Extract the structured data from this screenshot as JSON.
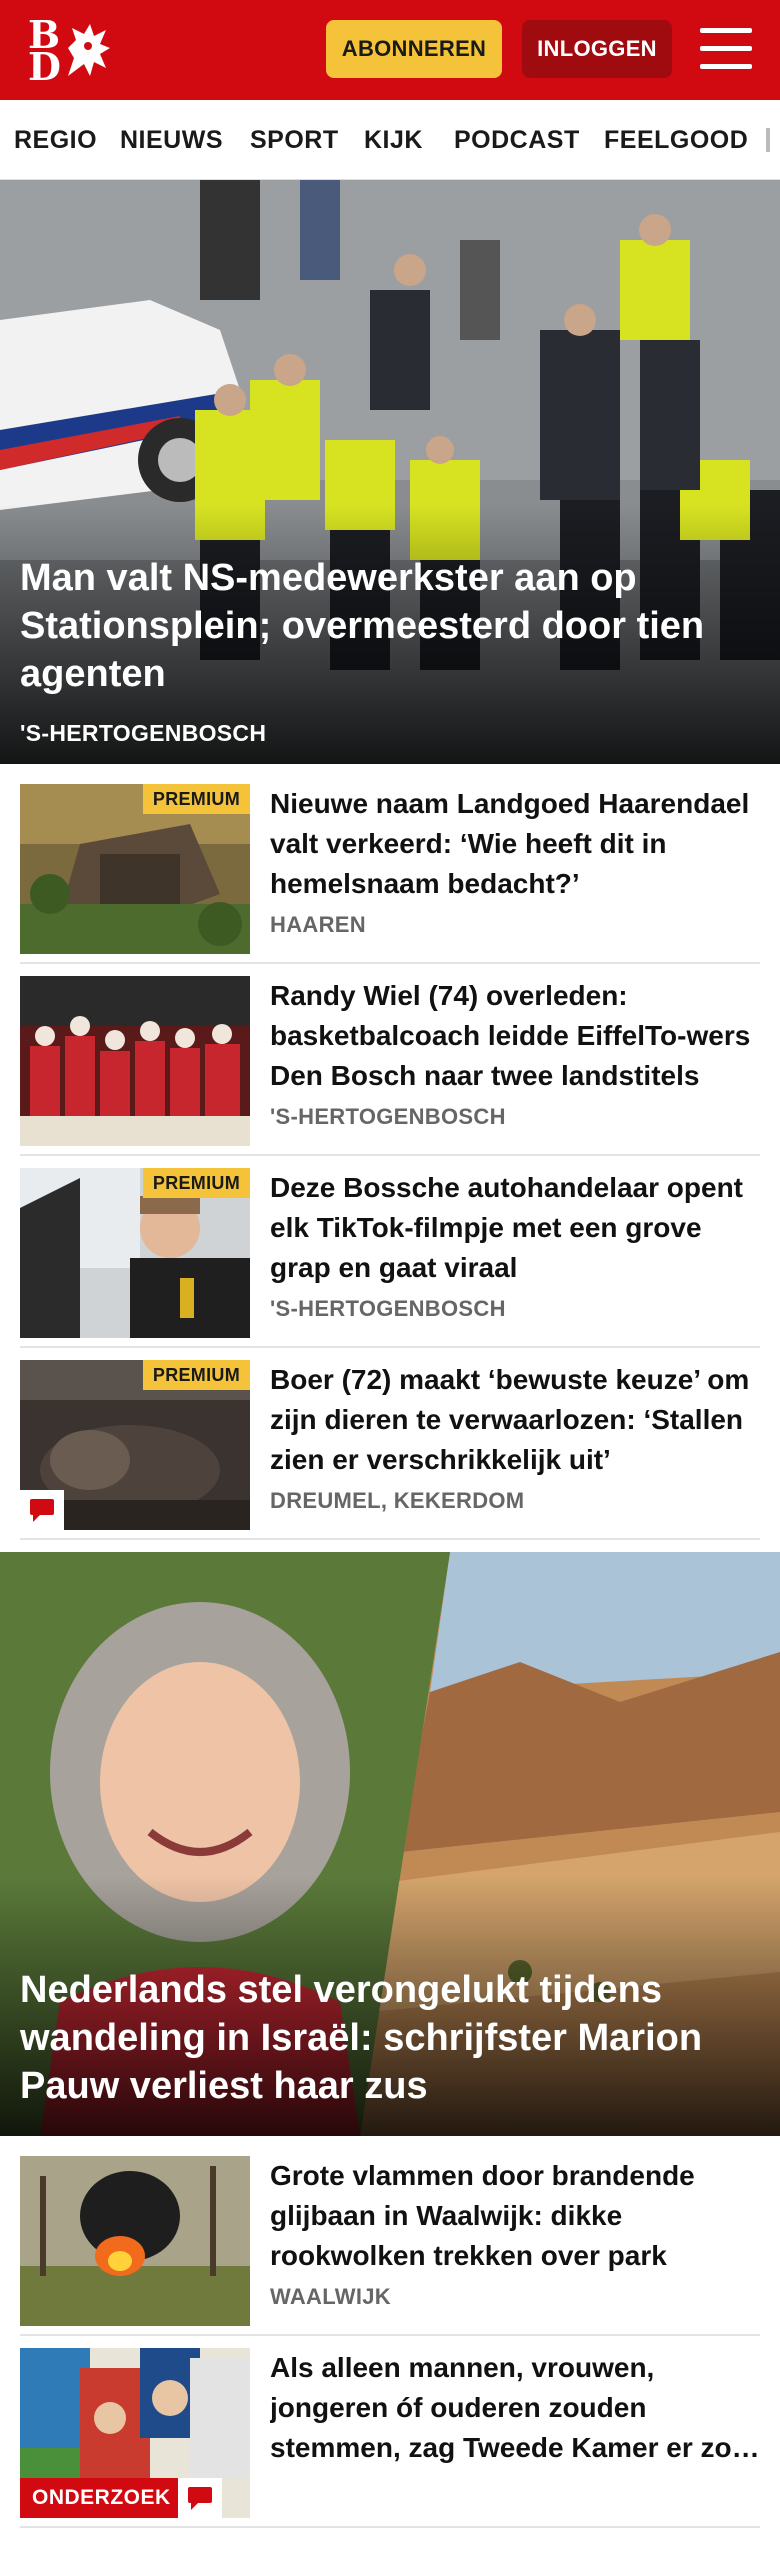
{
  "header": {
    "subscribe_label": "ABONNEREN",
    "login_label": "INLOGGEN",
    "colors": {
      "brand": "#d10a11",
      "subscribe": "#f5c33a",
      "login": "#a00b10"
    }
  },
  "nav": {
    "items": [
      "REGIO",
      "NIEUWS",
      "SPORT",
      "KIJK",
      "PODCAST",
      "FEELGOOD"
    ]
  },
  "hero1": {
    "title": "Man valt NS-medewerkster aan op Stationsplein; overmeesterd door tien agenten",
    "location": "'S-HERTOGENBOSCH"
  },
  "articles1": [
    {
      "title": "Nieuwe naam Landgoed Haarendael valt verkeerd: ‘Wie heeft dit in hemelsnaam bedacht?’",
      "location": "HAAREN",
      "badge": "PREMIUM"
    },
    {
      "title": "Randy Wiel (74) overleden: basketbalcoach leidde EiffelTo-wers Den Bosch naar twee landstitels",
      "location": "'S-HERTOGENBOSCH"
    },
    {
      "title": "Deze Bossche autohandelaar opent elk TikTok-filmpje met een grove grap en gaat viraal",
      "location": "'S-HERTOGENBOSCH",
      "badge": "PREMIUM"
    },
    {
      "title": "Boer (72) maakt ‘bewuste keuze’ om zijn dieren te verwaarlozen: ‘Stallen zien er verschrikkelijk uit’",
      "location": "DREUMEL, KEKERDOM",
      "badge": "PREMIUM"
    }
  ],
  "hero2": {
    "title": "Nederlands stel verongelukt tijdens wandeling in Israël: schrijfster Marion Pauw verliest haar zus"
  },
  "articles2": [
    {
      "title": "Grote vlammen door brandende glijbaan in Waalwijk: dikke rookwolken trekken over park",
      "location": "WAALWIJK"
    },
    {
      "title": "Als alleen mannen, vrouwen, jongeren óf ouderen zouden stemmen, zag Tweede Kamer er zo uit",
      "badge": "ONDERZOEK"
    }
  ]
}
